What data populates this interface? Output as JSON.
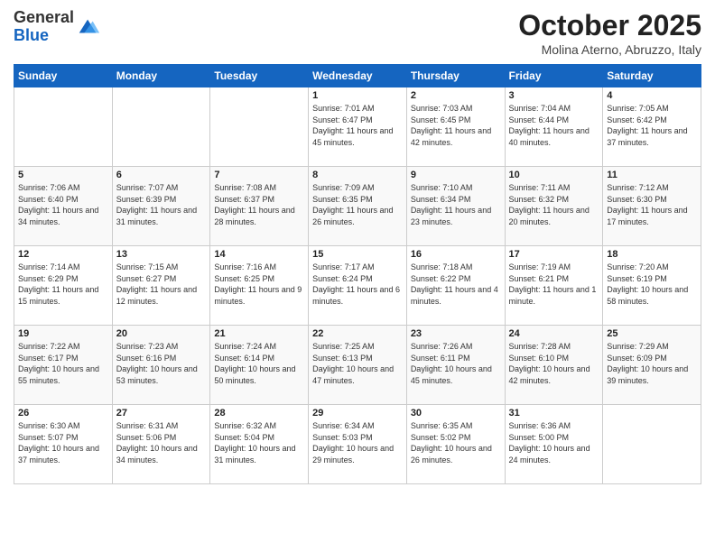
{
  "header": {
    "logo_general": "General",
    "logo_blue": "Blue",
    "month_title": "October 2025",
    "location": "Molina Aterno, Abruzzo, Italy"
  },
  "weekdays": [
    "Sunday",
    "Monday",
    "Tuesday",
    "Wednesday",
    "Thursday",
    "Friday",
    "Saturday"
  ],
  "weeks": [
    [
      {
        "day": "",
        "info": ""
      },
      {
        "day": "",
        "info": ""
      },
      {
        "day": "",
        "info": ""
      },
      {
        "day": "1",
        "info": "Sunrise: 7:01 AM\nSunset: 6:47 PM\nDaylight: 11 hours and 45 minutes."
      },
      {
        "day": "2",
        "info": "Sunrise: 7:03 AM\nSunset: 6:45 PM\nDaylight: 11 hours and 42 minutes."
      },
      {
        "day": "3",
        "info": "Sunrise: 7:04 AM\nSunset: 6:44 PM\nDaylight: 11 hours and 40 minutes."
      },
      {
        "day": "4",
        "info": "Sunrise: 7:05 AM\nSunset: 6:42 PM\nDaylight: 11 hours and 37 minutes."
      }
    ],
    [
      {
        "day": "5",
        "info": "Sunrise: 7:06 AM\nSunset: 6:40 PM\nDaylight: 11 hours and 34 minutes."
      },
      {
        "day": "6",
        "info": "Sunrise: 7:07 AM\nSunset: 6:39 PM\nDaylight: 11 hours and 31 minutes."
      },
      {
        "day": "7",
        "info": "Sunrise: 7:08 AM\nSunset: 6:37 PM\nDaylight: 11 hours and 28 minutes."
      },
      {
        "day": "8",
        "info": "Sunrise: 7:09 AM\nSunset: 6:35 PM\nDaylight: 11 hours and 26 minutes."
      },
      {
        "day": "9",
        "info": "Sunrise: 7:10 AM\nSunset: 6:34 PM\nDaylight: 11 hours and 23 minutes."
      },
      {
        "day": "10",
        "info": "Sunrise: 7:11 AM\nSunset: 6:32 PM\nDaylight: 11 hours and 20 minutes."
      },
      {
        "day": "11",
        "info": "Sunrise: 7:12 AM\nSunset: 6:30 PM\nDaylight: 11 hours and 17 minutes."
      }
    ],
    [
      {
        "day": "12",
        "info": "Sunrise: 7:14 AM\nSunset: 6:29 PM\nDaylight: 11 hours and 15 minutes."
      },
      {
        "day": "13",
        "info": "Sunrise: 7:15 AM\nSunset: 6:27 PM\nDaylight: 11 hours and 12 minutes."
      },
      {
        "day": "14",
        "info": "Sunrise: 7:16 AM\nSunset: 6:25 PM\nDaylight: 11 hours and 9 minutes."
      },
      {
        "day": "15",
        "info": "Sunrise: 7:17 AM\nSunset: 6:24 PM\nDaylight: 11 hours and 6 minutes."
      },
      {
        "day": "16",
        "info": "Sunrise: 7:18 AM\nSunset: 6:22 PM\nDaylight: 11 hours and 4 minutes."
      },
      {
        "day": "17",
        "info": "Sunrise: 7:19 AM\nSunset: 6:21 PM\nDaylight: 11 hours and 1 minute."
      },
      {
        "day": "18",
        "info": "Sunrise: 7:20 AM\nSunset: 6:19 PM\nDaylight: 10 hours and 58 minutes."
      }
    ],
    [
      {
        "day": "19",
        "info": "Sunrise: 7:22 AM\nSunset: 6:17 PM\nDaylight: 10 hours and 55 minutes."
      },
      {
        "day": "20",
        "info": "Sunrise: 7:23 AM\nSunset: 6:16 PM\nDaylight: 10 hours and 53 minutes."
      },
      {
        "day": "21",
        "info": "Sunrise: 7:24 AM\nSunset: 6:14 PM\nDaylight: 10 hours and 50 minutes."
      },
      {
        "day": "22",
        "info": "Sunrise: 7:25 AM\nSunset: 6:13 PM\nDaylight: 10 hours and 47 minutes."
      },
      {
        "day": "23",
        "info": "Sunrise: 7:26 AM\nSunset: 6:11 PM\nDaylight: 10 hours and 45 minutes."
      },
      {
        "day": "24",
        "info": "Sunrise: 7:28 AM\nSunset: 6:10 PM\nDaylight: 10 hours and 42 minutes."
      },
      {
        "day": "25",
        "info": "Sunrise: 7:29 AM\nSunset: 6:09 PM\nDaylight: 10 hours and 39 minutes."
      }
    ],
    [
      {
        "day": "26",
        "info": "Sunrise: 6:30 AM\nSunset: 5:07 PM\nDaylight: 10 hours and 37 minutes."
      },
      {
        "day": "27",
        "info": "Sunrise: 6:31 AM\nSunset: 5:06 PM\nDaylight: 10 hours and 34 minutes."
      },
      {
        "day": "28",
        "info": "Sunrise: 6:32 AM\nSunset: 5:04 PM\nDaylight: 10 hours and 31 minutes."
      },
      {
        "day": "29",
        "info": "Sunrise: 6:34 AM\nSunset: 5:03 PM\nDaylight: 10 hours and 29 minutes."
      },
      {
        "day": "30",
        "info": "Sunrise: 6:35 AM\nSunset: 5:02 PM\nDaylight: 10 hours and 26 minutes."
      },
      {
        "day": "31",
        "info": "Sunrise: 6:36 AM\nSunset: 5:00 PM\nDaylight: 10 hours and 24 minutes."
      },
      {
        "day": "",
        "info": ""
      }
    ]
  ]
}
